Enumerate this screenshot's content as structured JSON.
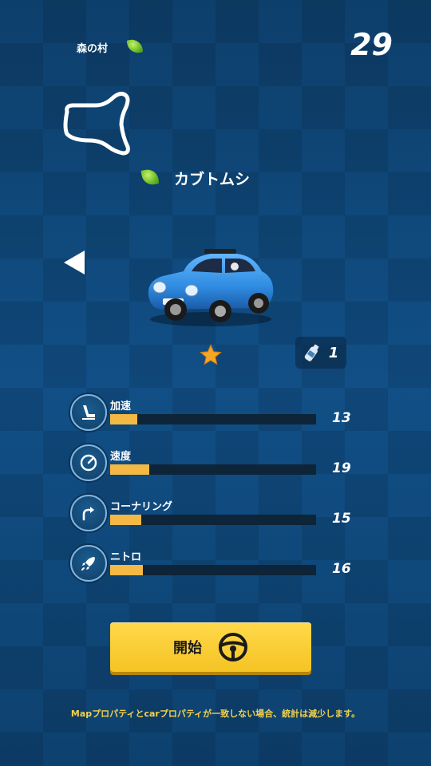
{
  "header": {
    "map_name": "森の村",
    "timer": "29"
  },
  "car": {
    "name": "カブトムシ",
    "stars": 1,
    "nitro_count": "1",
    "car_color": "#2e8be0"
  },
  "stats": [
    {
      "label": "加速",
      "value": "13",
      "fill_fraction": 0.13,
      "icon": "seat-icon"
    },
    {
      "label": "速度",
      "value": "19",
      "fill_fraction": 0.19,
      "icon": "speedometer-icon"
    },
    {
      "label": "コーナリング",
      "value": "15",
      "fill_fraction": 0.15,
      "icon": "curve-arrow-icon"
    },
    {
      "label": "ニトロ",
      "value": "16",
      "fill_fraction": 0.16,
      "icon": "rocket-icon"
    }
  ],
  "start_button": {
    "label": "開始",
    "icon": "steering-wheel-icon"
  },
  "footer_note": "Mapプロパティとcarプロパティが一致しない場合、統計は減少します。",
  "colors": {
    "accent_yellow": "#f5c424",
    "bar_fill": "#f4b845",
    "bar_bg": "#0e2438",
    "footer_text": "#f4d24a"
  }
}
